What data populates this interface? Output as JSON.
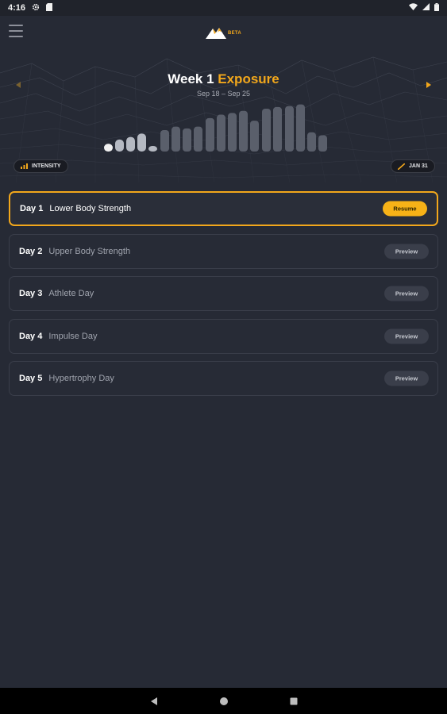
{
  "status_bar": {
    "time": "4:16",
    "icons": [
      "gear-icon",
      "sd-card-icon",
      "wifi-icon",
      "signal-icon",
      "battery-icon"
    ]
  },
  "app_bar": {
    "logo_badge": "BETA",
    "menu_icon": "hamburger-menu-icon",
    "accent_color": "#f2a71b"
  },
  "week": {
    "number_label": "Week 1",
    "phase": "Exposure",
    "dates": "Sep 18 – Sep 25",
    "prev_icon": "caret-left-icon",
    "next_icon": "caret-right-icon"
  },
  "chips": {
    "intensity_label": "INTENSITY",
    "intensity_icon": "bar-chart-icon",
    "date_label": "JAN 31",
    "date_icon": "trend-line-icon"
  },
  "days": [
    {
      "num": "Day 1",
      "name": "Lower Body Strength",
      "button": "Resume",
      "active": true
    },
    {
      "num": "Day 2",
      "name": "Upper Body Strength",
      "button": "Preview",
      "active": false
    },
    {
      "num": "Day 3",
      "name": "Athlete Day",
      "button": "Preview",
      "active": false
    },
    {
      "num": "Day 4",
      "name": "Impulse Day",
      "button": "Preview",
      "active": false
    },
    {
      "num": "Day 5",
      "name": "Hypertrophy Day",
      "button": "Preview",
      "active": false
    }
  ],
  "nav_bar": {
    "icons": [
      "back-triangle-icon",
      "home-circle-icon",
      "recents-square-icon"
    ]
  },
  "colors": {
    "background": "#262a35",
    "accent": "#f2a71b",
    "resume_button": "#f7b217",
    "card_border": "#3a3e4a"
  },
  "chart_data": {
    "type": "bar",
    "description_levels": "relative intensity",
    "values": [
      0.18,
      0.28,
      0.34,
      0.42,
      0.12,
      0.5,
      0.58,
      0.54,
      0.58,
      0.78,
      0.86,
      0.9,
      0.95,
      0.72,
      1.0,
      1.04,
      1.06,
      1.1,
      0.45,
      0.38
    ],
    "highlighted_index": 0
  }
}
